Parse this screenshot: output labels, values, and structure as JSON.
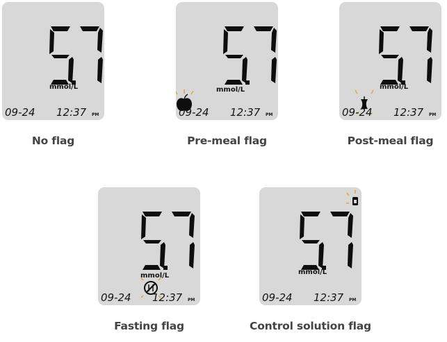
{
  "colors": {
    "screen": "#d8d8d8",
    "ink": "#0e0e0e",
    "flash": "#e8a020",
    "caption": "#444444"
  },
  "reading": {
    "value": "5.7",
    "unit": "mmol/L",
    "date": "09-24",
    "time": "12:37",
    "meridiem": "PM"
  },
  "panels": [
    {
      "id": "no-flag",
      "caption": "No flag",
      "icon": null
    },
    {
      "id": "pre-meal",
      "caption": "Pre-meal flag",
      "icon": "apple-icon"
    },
    {
      "id": "post-meal",
      "caption": "Post-meal flag",
      "icon": "apple-core-icon"
    },
    {
      "id": "fasting",
      "caption": "Fasting flag",
      "icon": "fasting-icon"
    },
    {
      "id": "control",
      "caption": "Control solution flag",
      "icon": "control-bottle-icon"
    }
  ]
}
